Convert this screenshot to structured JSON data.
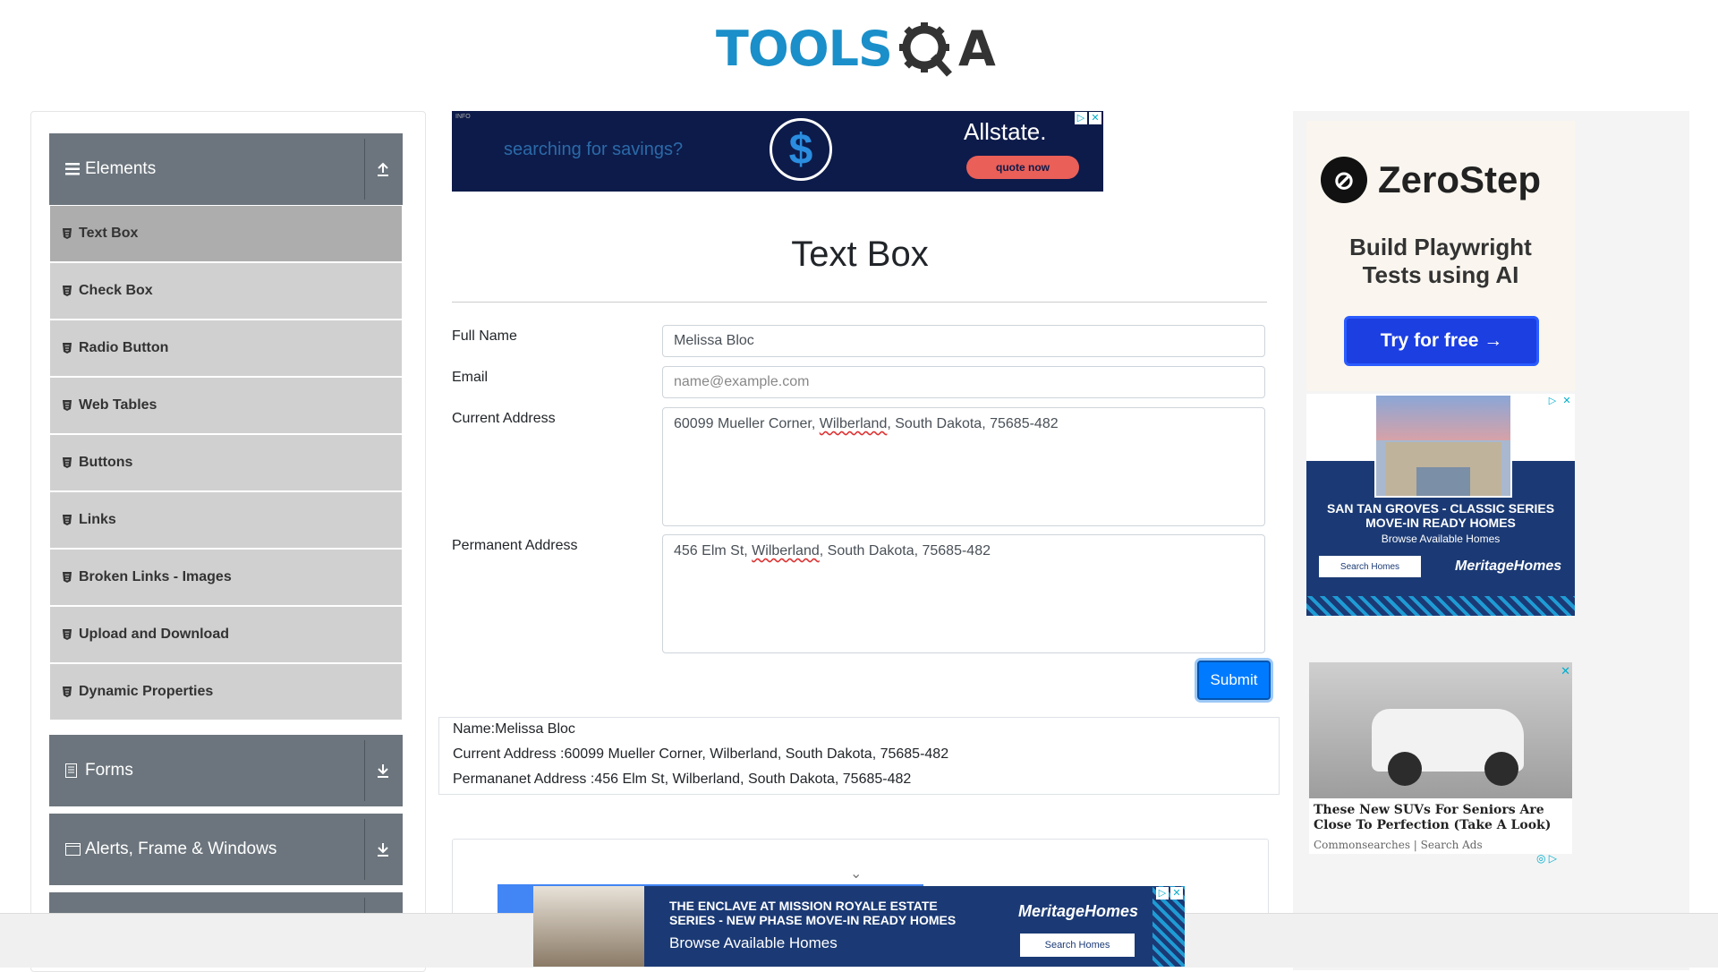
{
  "header": {
    "logo_part1": "TOOLS",
    "logo_part2": "QA"
  },
  "sidebar": {
    "groups": [
      {
        "label": "Elements",
        "icon": "hamburger-icon",
        "toggle": "collapse-up-icon"
      },
      {
        "label": "Forms",
        "icon": "document-icon",
        "toggle": "expand-down-icon"
      },
      {
        "label": "Alerts, Frame & Windows",
        "icon": "window-icon",
        "toggle": "expand-down-icon"
      }
    ],
    "items": [
      {
        "label": "Text Box",
        "active": true
      },
      {
        "label": "Check Box"
      },
      {
        "label": "Radio Button"
      },
      {
        "label": "Web Tables"
      },
      {
        "label": "Buttons"
      },
      {
        "label": "Links"
      },
      {
        "label": "Broken Links - Images"
      },
      {
        "label": "Upload and Download"
      },
      {
        "label": "Dynamic Properties"
      }
    ]
  },
  "top_ad": {
    "text": "searching for savings?",
    "brand": "Allstate.",
    "cta": "quote now",
    "tag": "INFO",
    "symbol": "$"
  },
  "page": {
    "title": "Text Box"
  },
  "form": {
    "full_name_label": "Full Name",
    "full_name_value": "Melissa Bloc",
    "email_label": "Email",
    "email_placeholder": "name@example.com",
    "current_address_label": "Current Address",
    "current_address_pre": "60099 Mueller Corner, ",
    "current_address_city": "Wilberland",
    "current_address_post": ", South Dakota, 75685-482",
    "permanent_address_label": "Permanent Address",
    "permanent_address_pre": "456 Elm St, ",
    "permanent_address_city": "Wilberland",
    "permanent_address_post": ", South Dakota, 75685-482",
    "submit_label": "Submit"
  },
  "output": {
    "name": "Name:Melissa Bloc",
    "current": "Current Address :60099 Mueller Corner, Wilberland, South Dakota, 75685-482",
    "permanent": "Permananet Address :456 Elm St, Wilberland, South Dakota, 75685-482"
  },
  "right_ads": {
    "zerostep_brand": "ZeroStep",
    "zerostep_sub_1": "Build Playwright",
    "zerostep_sub_2": "Tests using AI",
    "zerostep_cta": "Try for free →",
    "meritage1_head_1": "SAN TAN GROVES - CLASSIC SERIES",
    "meritage1_head_2": "MOVE-IN READY HOMES",
    "meritage1_sub": "Browse Available Homes",
    "meritage1_btn": "Search Homes",
    "meritage1_brand": "MeritageHomes",
    "suv_title": "These New SUVs For Seniors Are Close To Perfection (Take A Look)",
    "suv_source": "Commonsearches | Search Ads"
  },
  "bottom_ad": {
    "head_1": "THE ENCLAVE AT MISSION ROYALE ESTATE",
    "head_2": "SERIES - NEW PHASE MOVE-IN READY HOMES",
    "sub": "Browse Available Homes",
    "brand": "MeritageHomes",
    "btn": "Search Homes"
  },
  "colors": {
    "accent": "#007bff",
    "sidebar_group": "#6c757d",
    "menu_item": "#d0d0d0",
    "menu_active": "#adadad",
    "logo_blue": "#1a8fc9"
  }
}
